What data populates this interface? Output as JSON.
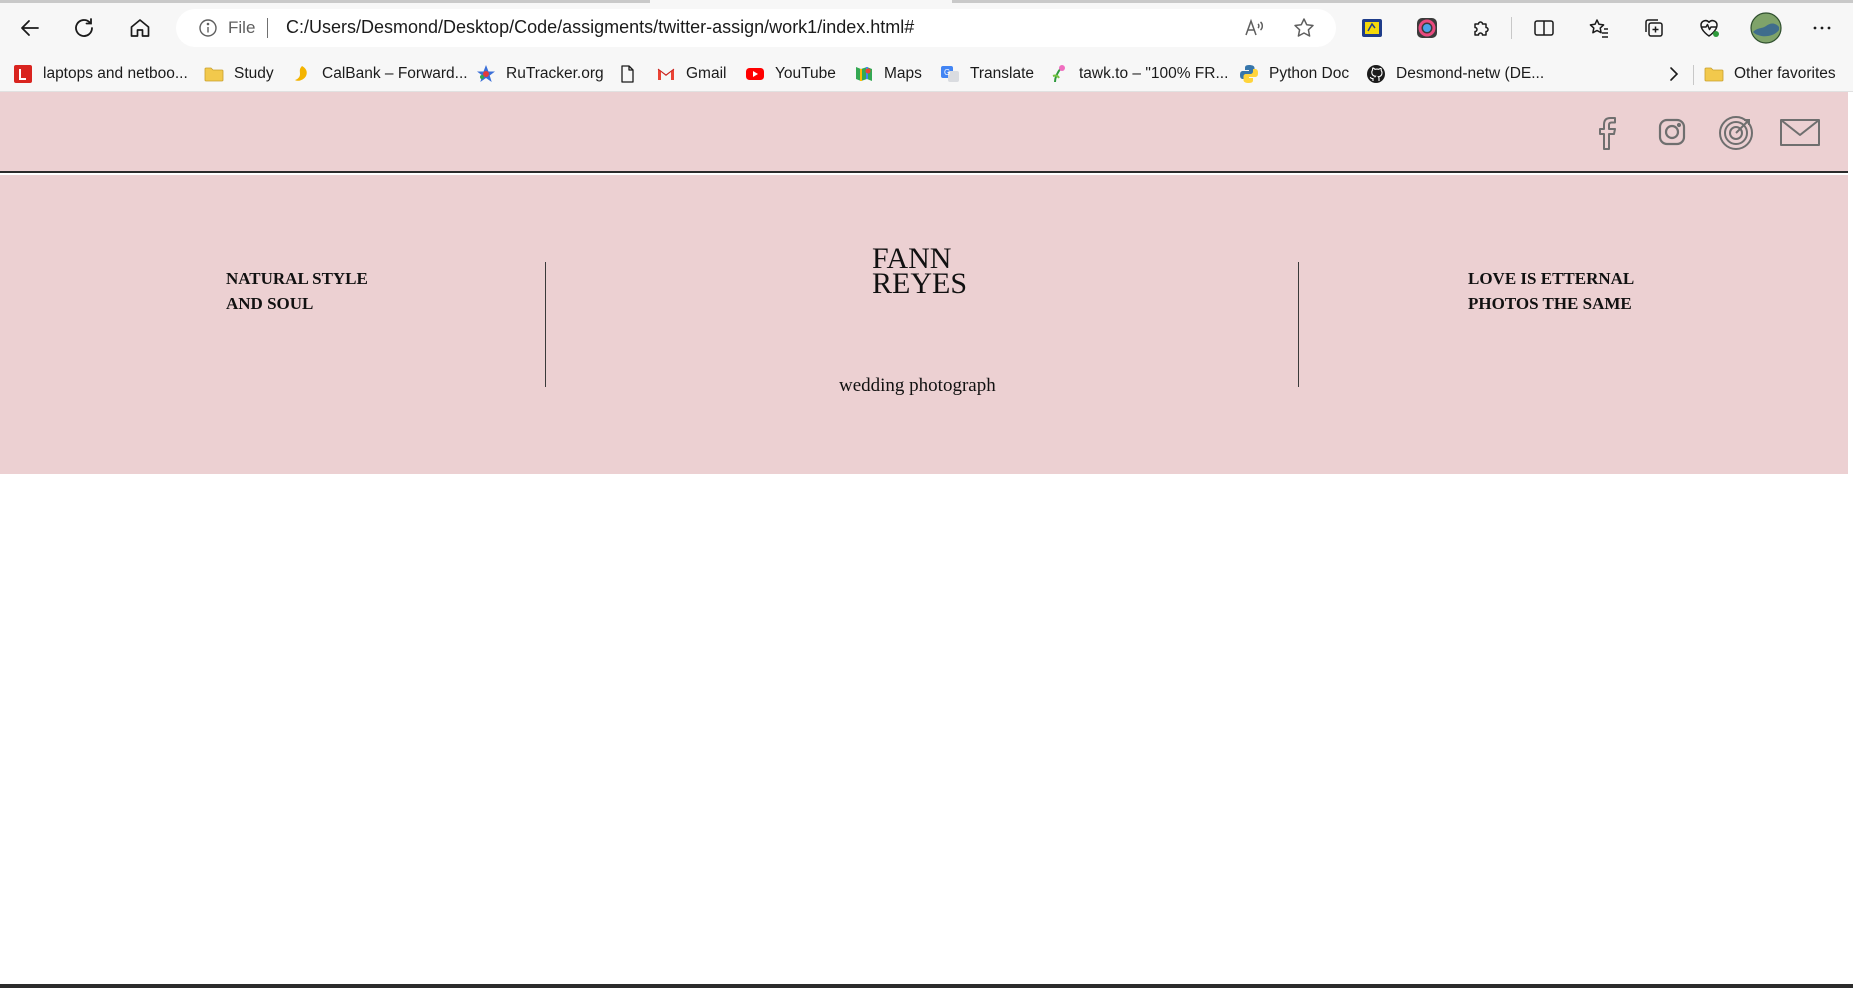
{
  "browser": {
    "file_label": "File",
    "url": "C:/Users/Desmond/Desktop/Code/assigments/twitter-assign/work1/index.html#",
    "bookmarks": [
      {
        "label": "laptops and netboo...",
        "icon": "laptop-store-icon"
      },
      {
        "label": "Study",
        "icon": "folder-icon"
      },
      {
        "label": "CalBank – Forward...",
        "icon": "calbank-icon"
      },
      {
        "label": "RuTracker.org",
        "icon": "rutracker-icon"
      },
      {
        "label": "",
        "icon": "page-icon"
      },
      {
        "label": "Gmail",
        "icon": "gmail-icon"
      },
      {
        "label": "YouTube",
        "icon": "youtube-icon"
      },
      {
        "label": "Maps",
        "icon": "maps-icon"
      },
      {
        "label": "Translate",
        "icon": "translate-icon"
      },
      {
        "label": "tawk.to – \"100% FR...",
        "icon": "tawk-icon"
      },
      {
        "label": "Python Doc",
        "icon": "python-icon"
      },
      {
        "label": "Desmond-netw (DE...",
        "icon": "github-icon"
      }
    ],
    "other_favorites": "Other favorites"
  },
  "site": {
    "social_icons": [
      "facebook-icon",
      "instagram-icon",
      "target-icon",
      "mail-icon"
    ],
    "left_tagline": [
      "NATURAL STYLE",
      "AND SOUL"
    ],
    "brand": [
      "FANN",
      "REYES"
    ],
    "subtitle": "wedding photograph",
    "right_tagline": [
      "LOVE IS ETTERNAL",
      "PHOTOS THE SAME"
    ],
    "colors": {
      "hero_bg": "#ecd0d2",
      "rule": "#2b2b2b"
    }
  }
}
